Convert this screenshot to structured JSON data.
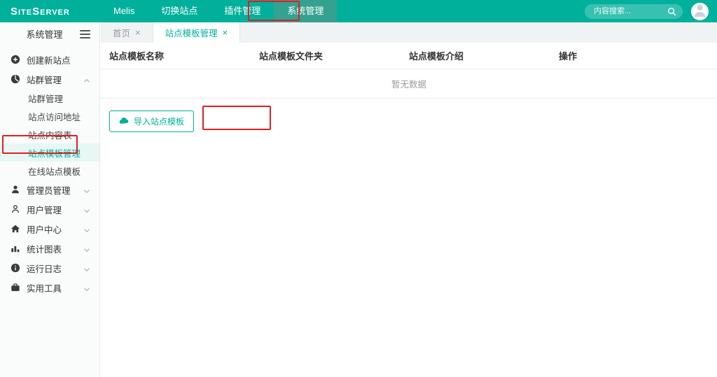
{
  "topbar": {
    "logo": "SiteServer",
    "nav": [
      {
        "label": "Melis"
      },
      {
        "label": "切换站点"
      },
      {
        "label": "插件管理"
      },
      {
        "label": "系统管理",
        "active": true
      }
    ],
    "search": {
      "placeholder": "内容搜索..."
    }
  },
  "sidebar": {
    "title": "系统管理",
    "items": [
      {
        "label": "创建新站点",
        "icon": "plus-circle-icon"
      },
      {
        "label": "站群管理",
        "icon": "sites-icon",
        "expanded": true,
        "children": [
          {
            "label": "站群管理"
          },
          {
            "label": "站点访问地址"
          },
          {
            "label": "站点内容表"
          },
          {
            "label": "站点模板管理",
            "active": true
          },
          {
            "label": "在线站点模板"
          }
        ]
      },
      {
        "label": "管理员管理",
        "icon": "admin-icon"
      },
      {
        "label": "用户管理",
        "icon": "user-icon"
      },
      {
        "label": "用户中心",
        "icon": "home-icon"
      },
      {
        "label": "统计图表",
        "icon": "chart-icon"
      },
      {
        "label": "运行日志",
        "icon": "info-icon"
      },
      {
        "label": "实用工具",
        "icon": "toolbox-icon"
      }
    ]
  },
  "tabs": [
    {
      "label": "首页",
      "close": "×"
    },
    {
      "label": "站点模板管理",
      "close": "×",
      "active": true
    }
  ],
  "table": {
    "columns": [
      "站点模板名称",
      "站点模板文件夹",
      "站点模板介绍",
      "操作"
    ],
    "empty_text": "暂无数据"
  },
  "actions": {
    "import_label": "导入站点模板"
  },
  "colors": {
    "accent": "#01b09b",
    "nav_active_bg": "#35a191",
    "sidebar_active_bg": "#e7f7f3",
    "annotation_red": "#e02020"
  }
}
